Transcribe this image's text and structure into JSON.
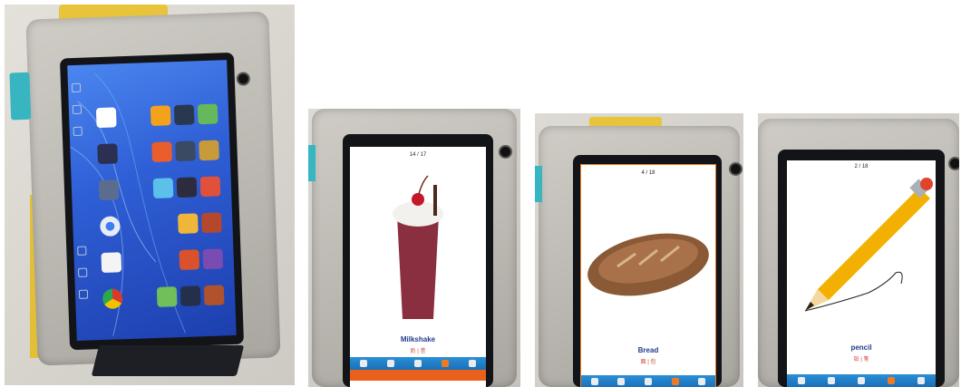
{
  "photos": [
    {
      "id": "home",
      "subject": "home-screen"
    },
    {
      "id": "milkshake",
      "counter": "14 / 17",
      "word": "Milkshake",
      "pinyin": "奶 | 昔"
    },
    {
      "id": "bread",
      "counter": "4 / 18",
      "word": "Bread",
      "pinyin": "面 | 包"
    },
    {
      "id": "pencil",
      "counter": "2 / 18",
      "word": "pencil",
      "pinyin": "铅 | 笔"
    }
  ],
  "colors": {
    "case": "#bdbab4",
    "bezel": "#121418",
    "homescreen_blue": "#2f5fd6",
    "toolbar_blue": "#1a6fb8",
    "label_blue": "#233c8c",
    "accent_orange": "#e8601c"
  }
}
